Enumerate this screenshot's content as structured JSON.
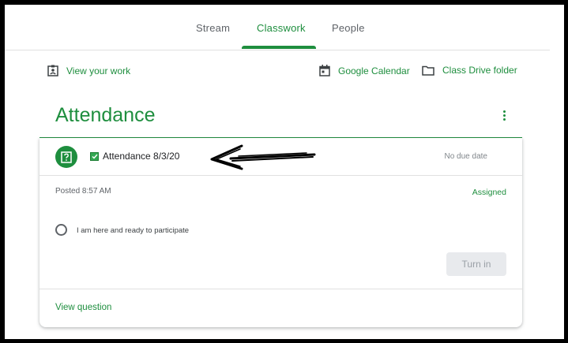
{
  "nav": {
    "tabs": [
      {
        "label": "Stream",
        "active": false
      },
      {
        "label": "Classwork",
        "active": true
      },
      {
        "label": "People",
        "active": false
      }
    ]
  },
  "actions": {
    "view_work": "View your work",
    "calendar": "Google Calendar",
    "drive": "Class Drive folder"
  },
  "topic": {
    "title": "Attendance"
  },
  "assignment": {
    "icon": "question-icon",
    "title": "Attendance 8/3/20",
    "due": "No due date",
    "posted": "Posted 8:57 AM",
    "status": "Assigned",
    "option_label": "I am here and ready to participate",
    "turn_in_label": "Turn in",
    "view_question_label": "View question"
  },
  "colors": {
    "accent": "#1e8e3e",
    "muted": "#5f6368",
    "disabled_bg": "#e8eaed"
  }
}
